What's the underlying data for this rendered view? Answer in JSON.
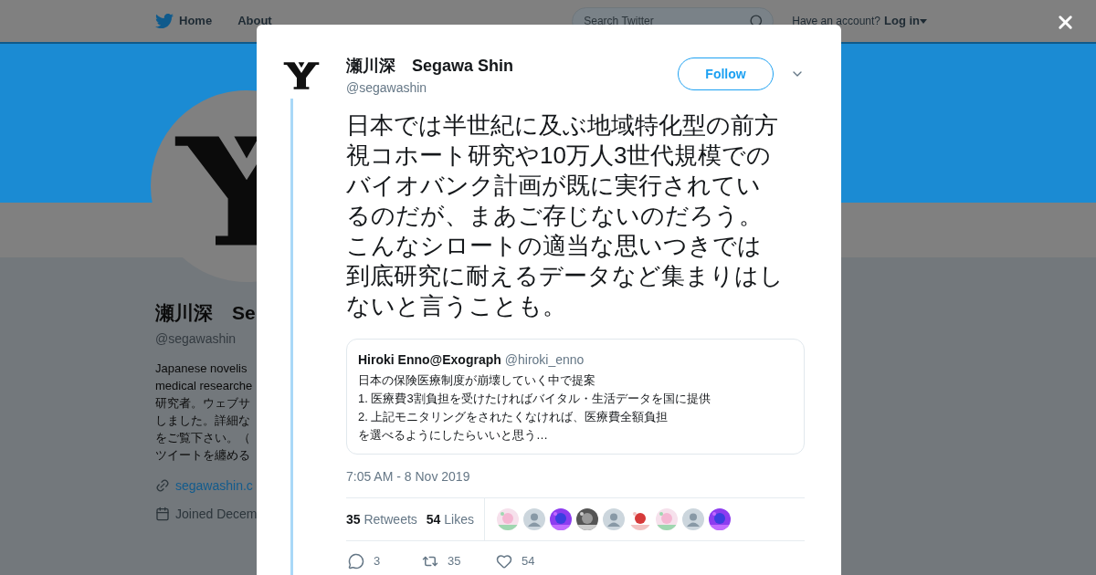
{
  "nav": {
    "links": [
      {
        "label": "Home",
        "kind": "home"
      },
      {
        "label": "About",
        "kind": "plain"
      }
    ],
    "search": {
      "placeholder": "Search Twitter"
    },
    "account_prompt": "Have an account?",
    "login": "Log in"
  },
  "profile": {
    "name": "瀬川深　Se",
    "handle": "@segawashin",
    "bio_lines": [
      "Japanese novelis",
      "medical researche",
      "研究者。ウェブサ",
      "しました。詳細な",
      "をご覧下さい。（",
      "ツイートを纏める"
    ],
    "website": "segawashin.c",
    "joined": "Joined Decem"
  },
  "tweet": {
    "author": {
      "name": "瀬川深　Segawa Shin",
      "handle": "@segawashin"
    },
    "follow": "Follow",
    "text_lines": [
      "日本では半世紀に及ぶ地域特化型の前方",
      "視コホート研究や10万人3世代規模での",
      "バイオバンク計画が既に実行されてい",
      "るのだが、まあご存じないのだろう。",
      "こんなシロートの適当な思いつきでは",
      "到底研究に耐えるデータなど集まりはし",
      "ないと言うことも。"
    ],
    "quote": {
      "name": "Hiroki Enno@Exograph",
      "handle": "@hiroki_enno",
      "lines": [
        "日本の保険医療制度が崩壊していく中で提案",
        "1. 医療費3割負担を受けたければバイタル・生活データを国に提供",
        "2. 上記モニタリングをされたくなければ、医療費全額負担",
        "を選べるようにしたらいいと思う…"
      ]
    },
    "timestamp": "7:05 AM - 8 Nov 2019",
    "retweets": {
      "count": "35",
      "label": "Retweets"
    },
    "likes": {
      "count": "54",
      "label": "Likes"
    },
    "likers": [
      {
        "kind": "picture"
      },
      {
        "kind": "default"
      },
      {
        "kind": "picture"
      },
      {
        "kind": "picture"
      },
      {
        "kind": "default"
      },
      {
        "kind": "picture"
      },
      {
        "kind": "picture"
      },
      {
        "kind": "default"
      },
      {
        "kind": "picture"
      }
    ],
    "actions": [
      {
        "kind": "reply",
        "count": "3"
      },
      {
        "kind": "retweet",
        "count": "35"
      },
      {
        "kind": "like",
        "count": "54"
      }
    ]
  }
}
